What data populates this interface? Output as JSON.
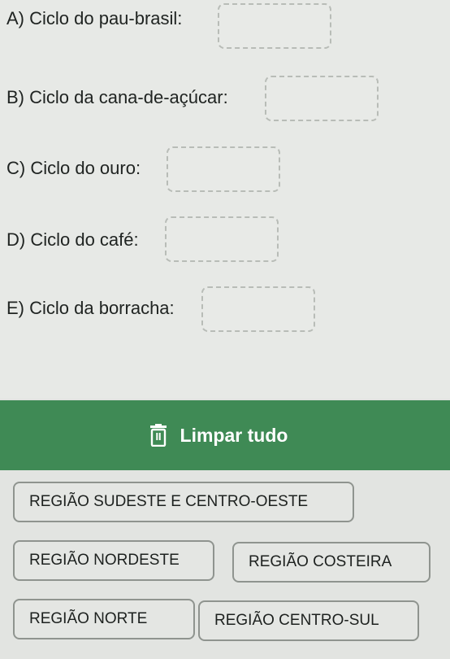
{
  "questions": [
    {
      "label": "A) Ciclo do pau-brasil:"
    },
    {
      "label": "B) Ciclo da cana-de-açúcar:"
    },
    {
      "label": "C) Ciclo do ouro:"
    },
    {
      "label": "D) Ciclo do café:"
    },
    {
      "label": "E) Ciclo da borracha:"
    }
  ],
  "clear_button": {
    "label": "Limpar tudo",
    "icon": "trash-icon"
  },
  "options": [
    {
      "label": "REGIÃO SUDESTE E CENTRO-OESTE"
    },
    {
      "label": "REGIÃO NORDESTE"
    },
    {
      "label": "REGIÃO COSTEIRA"
    },
    {
      "label": "REGIÃO NORTE"
    },
    {
      "label": "REGIÃO CENTRO-SUL"
    }
  ],
  "colors": {
    "accent": "#3f8a55",
    "background": "#e2e4e1"
  }
}
